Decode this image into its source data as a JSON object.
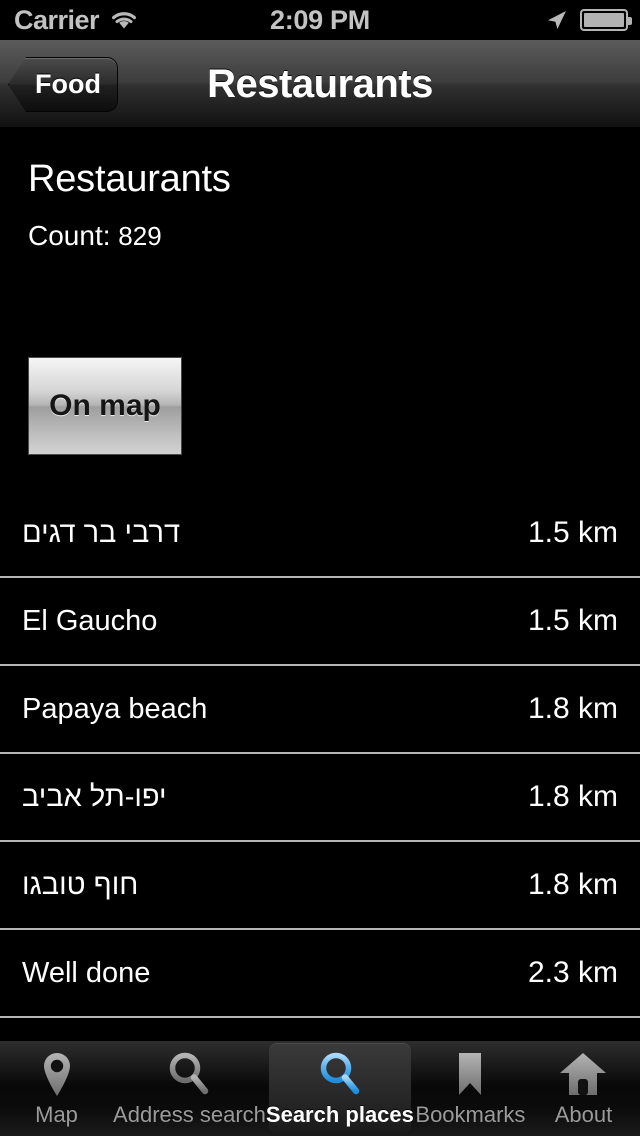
{
  "status_bar": {
    "carrier": "Carrier",
    "wifi_icon": "wifi-icon",
    "time": "2:09 PM",
    "location_icon": "location-arrow-icon",
    "battery_icon": "battery-icon"
  },
  "nav_bar": {
    "back_label": "Food",
    "back_icon": "chevron-left-icon",
    "title": "Restaurants"
  },
  "main": {
    "page_title": "Restaurants",
    "count_label": "Count:",
    "count_value": "829",
    "on_map_label": "On map",
    "rows": [
      {
        "name": "דרבי בר דגים",
        "distance": "1.5 km",
        "rtl": true
      },
      {
        "name": "El Gaucho",
        "distance": "1.5 km",
        "rtl": false
      },
      {
        "name": "Papaya beach",
        "distance": "1.8 km",
        "rtl": false
      },
      {
        "name": "יפו-תל אביב",
        "distance": "1.8 km",
        "rtl": true
      },
      {
        "name": "חוף טובגו",
        "distance": "1.8 km",
        "rtl": true
      },
      {
        "name": "Well done",
        "distance": "2.3 km",
        "rtl": false
      }
    ]
  },
  "tab_bar": {
    "selected_index": 2,
    "tabs": [
      {
        "label": "Map",
        "icon": "map-pin-icon"
      },
      {
        "label": "Address search",
        "icon": "magnifier-icon"
      },
      {
        "label": "Search places",
        "icon": "magnifier-icon"
      },
      {
        "label": "Bookmarks",
        "icon": "bookmark-icon"
      },
      {
        "label": "About",
        "icon": "home-icon"
      }
    ]
  },
  "colors": {
    "background": "#000000",
    "separator": "#b5b5b5",
    "text": "#ffffff",
    "status_text": "#c2c2c2",
    "tab_inactive": "#9b9b9b",
    "accent": "#4aa8f0"
  }
}
